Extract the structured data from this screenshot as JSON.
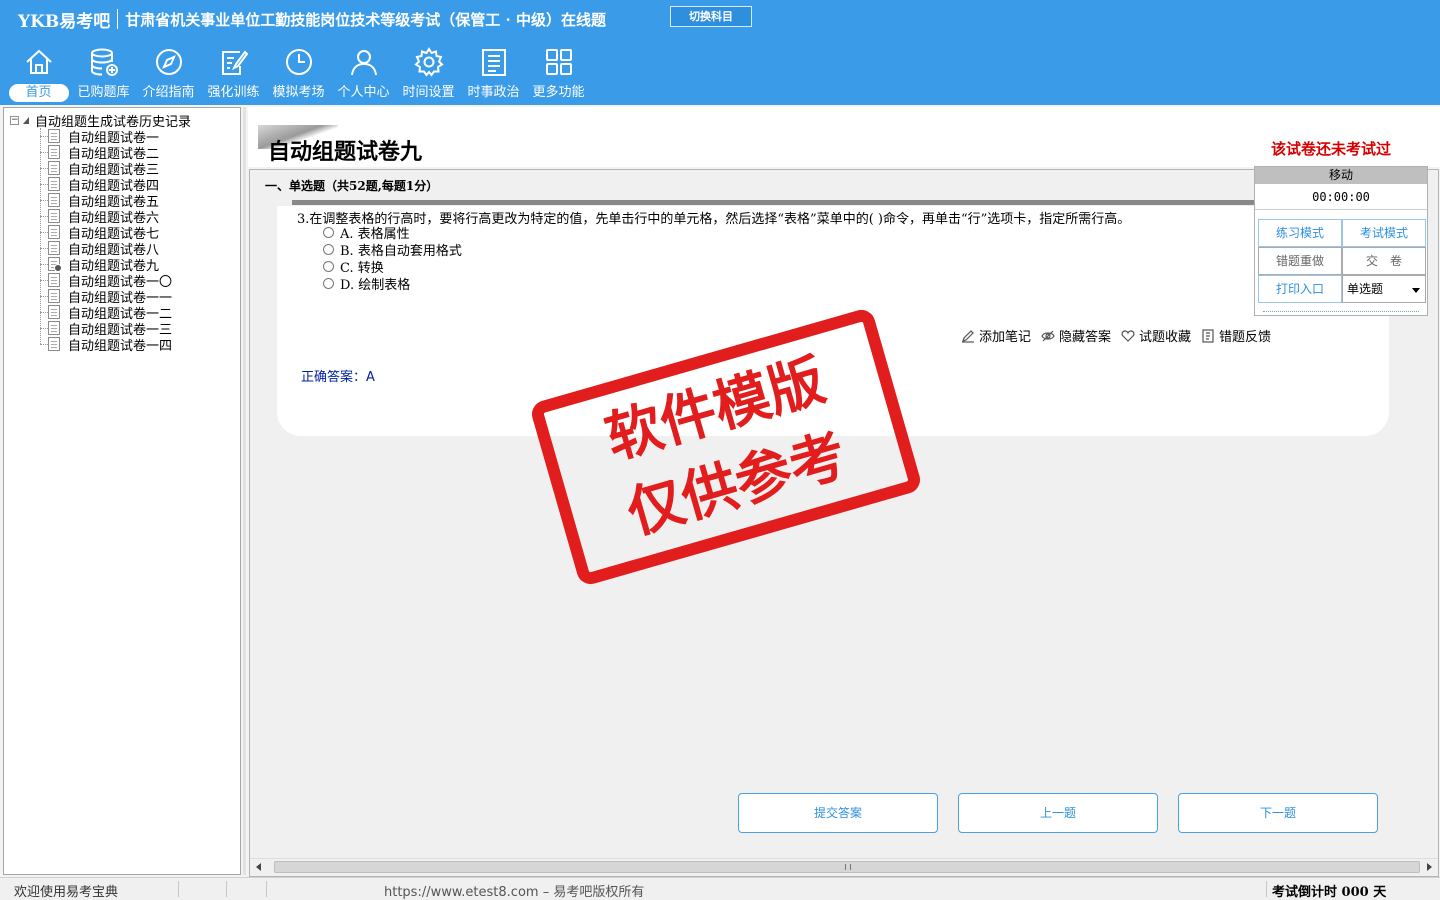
{
  "header": {
    "brand": "YKB易考吧",
    "title": "甘肃省机关事业单位工勤技能岗位技术等级考试（保管工 · 中级）在线题",
    "switch_label": "切换科目",
    "nav": [
      {
        "label": "首页",
        "icon": "home-icon"
      },
      {
        "label": "已购题库",
        "icon": "database-icon"
      },
      {
        "label": "介绍指南",
        "icon": "compass-icon"
      },
      {
        "label": "强化训练",
        "icon": "edit-icon"
      },
      {
        "label": "模拟考场",
        "icon": "clock-icon"
      },
      {
        "label": "个人中心",
        "icon": "user-icon"
      },
      {
        "label": "时间设置",
        "icon": "gear-icon"
      },
      {
        "label": "时事政治",
        "icon": "news-icon"
      },
      {
        "label": "更多功能",
        "icon": "grid-icon"
      }
    ]
  },
  "tree": {
    "root": "自动组题生成试卷历史记录",
    "items": [
      "自动组题试卷一",
      "自动组题试卷二",
      "自动组题试卷三",
      "自动组题试卷四",
      "自动组题试卷五",
      "自动组题试卷六",
      "自动组题试卷七",
      "自动组题试卷八",
      "自动组题试卷九",
      "自动组题试卷一〇",
      "自动组题试卷一一",
      "自动组题试卷一二",
      "自动组题试卷一三",
      "自动组题试卷一四"
    ],
    "current_index": 8
  },
  "paper": {
    "title": "自动组题试卷九",
    "status": "该试卷还未考试过",
    "section": "一、单选题（共52题,每题1分）"
  },
  "question": {
    "text": "3.在调整表格的行高时，要将行高更改为特定的值，先单击行中的单元格，然后选择“表格”菜单中的( )命令，再单击“行”选项卡，指定所需行高。",
    "options": [
      "A. 表格属性",
      "B. 表格自动套用格式",
      "C. 转换",
      "D. 绘制表格"
    ],
    "tools": {
      "note": "添加笔记",
      "hide": "隐藏答案",
      "favorite": "试题收藏",
      "feedback": "错题反馈"
    },
    "answer_label": "正确答案：",
    "answer": "A"
  },
  "float_panel": {
    "title": "移动",
    "timer": "00:00:00",
    "practice_mode": "练习模式",
    "exam_mode": "考试模式",
    "redo_wrong": "错题重做",
    "submit_paper": "交　卷",
    "print": "打印入口",
    "type_select": "单选题"
  },
  "buttons": {
    "submit": "提交答案",
    "prev": "上一题",
    "next": "下一题"
  },
  "stamp": {
    "line1": "软件模版",
    "line2": "仅供参考"
  },
  "status": {
    "welcome": "欢迎使用易考宝典",
    "url": "https://www.etest8.com – 易考吧版权所有",
    "countdown": "考试倒计时 000 天"
  }
}
